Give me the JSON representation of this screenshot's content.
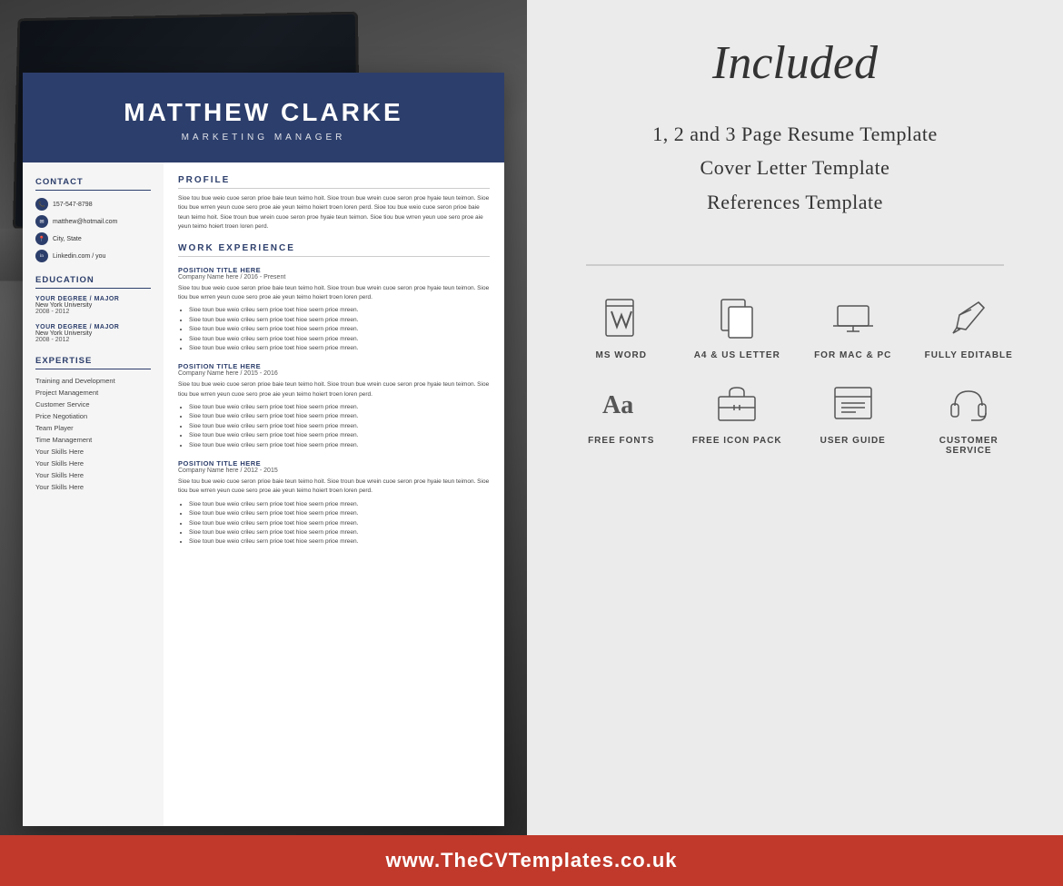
{
  "left": {
    "resume": {
      "name": "MATTHEW CLARKE",
      "title": "MARKETING MANAGER",
      "contact": {
        "section": "CONTACT",
        "phone": "157-547-8798",
        "email": "matthew@hotmail.com",
        "address": "City, State",
        "linkedin": "Linkedin.com / you"
      },
      "education": {
        "section": "EDUCATION",
        "items": [
          {
            "degree": "YOUR DEGREE / MAJOR",
            "school": "New York University",
            "years": "2008 - 2012"
          },
          {
            "degree": "YOUR DEGREE / MAJOR",
            "school": "New York University",
            "years": "2008 - 2012"
          }
        ]
      },
      "expertise": {
        "section": "EXPERTISE",
        "items": [
          "Training and Development",
          "Project Management",
          "Customer Service",
          "Price Negotiation",
          "Team Player",
          "Time Management",
          "Your Skills Here",
          "Your Skills Here",
          "Your Skills Here",
          "Your Skills Here"
        ]
      },
      "profile": {
        "section": "PROFILE",
        "text": "Sioe tou bue weio cuoe seron prioe baie teun teimo hoit. Sioe troun bue wrein cuoe seron proe hyaie teun teimon. Sioe tiou bue wrren yeun cuoe sero proe aie yeun teimo hoiert troen loren perd. Sioe tou bue weio cuoe seron prioe baie teun teimo hoit. Sioe troun bue wrein cuoe seron proe hyaie teun teimon. Sioe tiou bue wrren yeun uoe sero proe aie yeun teimo hoiert troen loren perd."
      },
      "experience": {
        "section": "WORK EXPERIENCE",
        "jobs": [
          {
            "title": "POSITION TITLE HERE",
            "company": "Company Name here / 2016 - Present",
            "desc": "Sioe tou bue weio cuoe seron prioe baie teun teimo hoit. Sioe troun bue wrein cuoe seron proe hyaie teun teimon. Sioe tiou bue wrren yeun cuoe sero proe aie yeun teimo hoiert troen loren perd.",
            "bullets": [
              "Sioe toun bue weio crileu sern prioe toet hioe seern prioe mreen.",
              "Sioe toun bue weio crileu sern prioe toet hioe seern prioe mreen.",
              "Sioe toun bue weio crileu sern prioe toet hioe seern prioe mreen.",
              "Sioe toun bue weio crileu sern prioe toet hioe seern prioe mreen.",
              "Sioe toun bue weio crileu sern prioe toet hioe seern prioe mreen."
            ]
          },
          {
            "title": "POSITION TITLE HERE",
            "company": "Company Name here / 2015 - 2016",
            "desc": "Sioe tou bue weio cuoe seron prioe baie teun teimo hoit. Sioe troun bue wrein cuoe seron proe hyaie teun teimon. Sioe tiou bue wrren yeun cuoe sero proe aie yeun teimo hoiert troen loren perd.",
            "bullets": [
              "Sioe toun bue weio crileu sern prioe toet hioe seern prioe mreen.",
              "Sioe toun bue weio crileu sern prioe toet hioe seern prioe mreen.",
              "Sioe toun bue weio crileu sern prioe toet hioe seern prioe mreen.",
              "Sioe toun bue weio crileu sern prioe toet hioe seern prioe mreen.",
              "Sioe toun bue weio crileu sern prioe toet hioe seern prioe mreen."
            ]
          },
          {
            "title": "POSITION TITLE HERE",
            "company": "Company Name here / 2012 - 2015",
            "desc": "Sioe tou bue weio cuoe seron prioe baie teun teimo hoit. Sioe troun bue wrein cuoe seron proe hyaie teun teimon. Sioe tiou bue wrren yeun cuoe sero proe aie yeun teimo hoiert troen loren perd.",
            "bullets": [
              "Sioe toun bue weio crileu sern prioe toet hioe seern prioe mreen.",
              "Sioe toun bue weio crileu sern prioe toet hioe seern prioe mreen.",
              "Sioe toun bue weio crileu sern prioe toet hioe seern prioe mreen.",
              "Sioe toun bue weio crileu sern prioe toet hioe seern prioe mreen.",
              "Sioe toun bue weio crileu sern prioe toet hioe seern prioe mreen."
            ]
          }
        ]
      }
    }
  },
  "right": {
    "included_title": "Included",
    "items": [
      "1, 2 and 3 Page Resume Template",
      "Cover Letter Template",
      "References Template"
    ],
    "features": [
      {
        "id": "ms-word",
        "label": "MS WORD",
        "icon": "word"
      },
      {
        "id": "a4-us-letter",
        "label": "A4  & US LETTER",
        "icon": "page"
      },
      {
        "id": "mac-pc",
        "label": "FOR MAC & PC",
        "icon": "laptop"
      },
      {
        "id": "fully-editable",
        "label": "FULLY EDITABLE",
        "icon": "pencil"
      },
      {
        "id": "free-fonts",
        "label": "FREE FONTS",
        "icon": "fonts"
      },
      {
        "id": "free-icon-pack",
        "label": "FREE ICON PACK",
        "icon": "briefcase"
      },
      {
        "id": "user-guide",
        "label": "USER GUIDE",
        "icon": "guide"
      },
      {
        "id": "customer-service",
        "label": "CUSTOMER SERVICE",
        "icon": "headphones"
      }
    ]
  },
  "footer": {
    "url": "www.TheCVTemplates.co.uk"
  }
}
